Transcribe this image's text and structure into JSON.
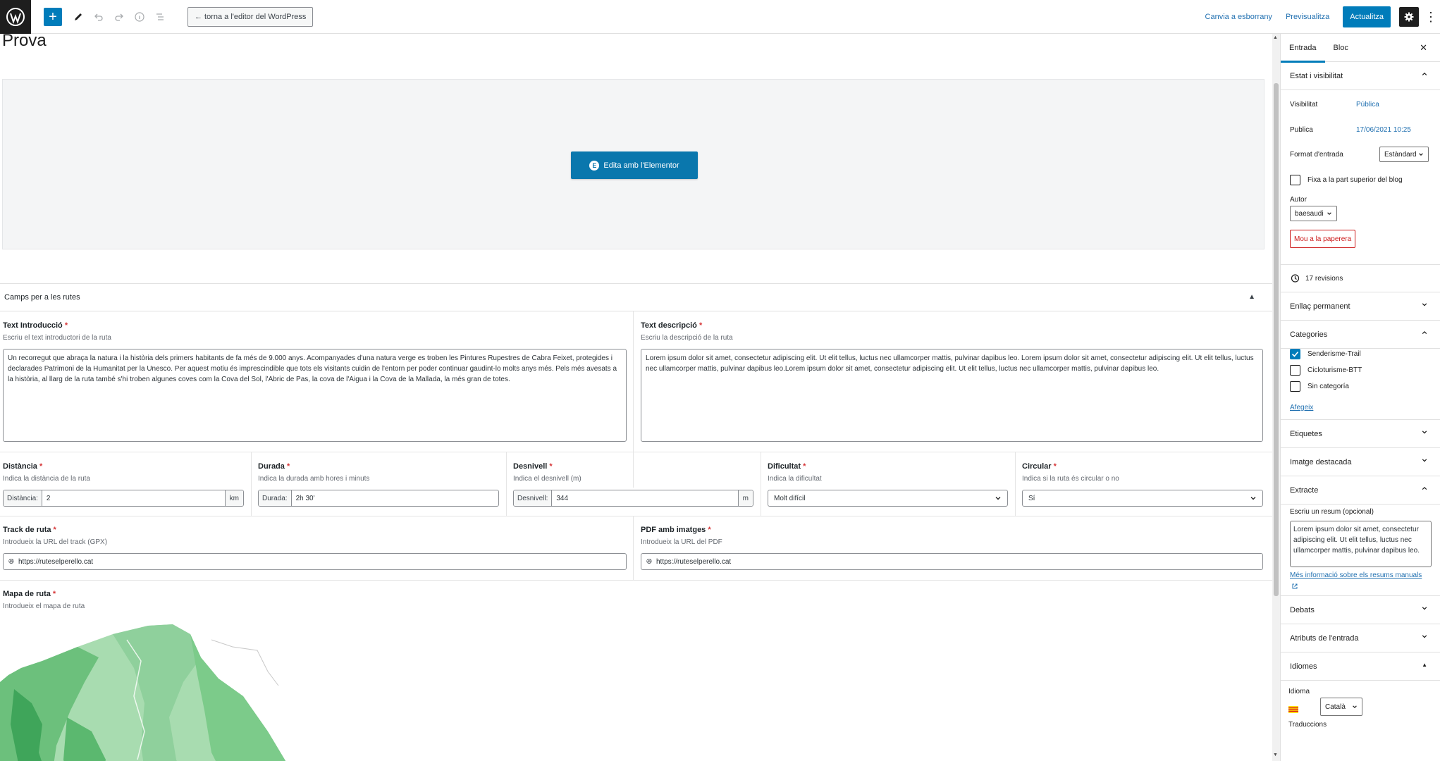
{
  "topbar": {
    "back_label": "← torna a l'editor del WordPress",
    "draft_label": "Canvia a esborrany",
    "preview_label": "Previsualitza",
    "update_label": "Actualitza"
  },
  "post": {
    "title": "Prova",
    "elementor_label": "Edita amb l'Elementor"
  },
  "metabox": {
    "title": "Camps per a les rutes"
  },
  "fields": {
    "intro": {
      "label": "Text Introducció",
      "required": "*",
      "desc": "Escriu el text introductori de la ruta",
      "value": "Un recorregut que abraça la natura i la història dels primers habitants de fa més de 9.000 anys. Acompanyades d'una natura verge es troben les Pintures Rupestres de Cabra Feixet, protegides i declarades Patrimoni de la Humanitat per la Unesco. Per aquest motiu és imprescindible que tots els visitants cuidin de l'entorn per poder continuar gaudint-lo molts anys més. Pels més avesats a la història, al llarg de la ruta també s'hi troben algunes coves com la Cova del Sol, l'Abric de Pas, la cova de l'Aigua i la Cova de la Mallada, la més gran de totes."
    },
    "descripcio": {
      "label": "Text descripció",
      "required": "*",
      "desc": "Escriu la descripció de la ruta",
      "value": "Lorem ipsum dolor sit amet, consectetur adipiscing elit. Ut elit tellus, luctus nec ullamcorper mattis, pulvinar dapibus leo. Lorem ipsum dolor sit amet, consectetur adipiscing elit. Ut elit tellus, luctus nec ullamcorper mattis, pulvinar dapibus leo.Lorem ipsum dolor sit amet, consectetur adipiscing elit. Ut elit tellus, luctus nec ullamcorper mattis, pulvinar dapibus leo."
    },
    "distancia": {
      "label": "Distància",
      "required": "*",
      "desc": "Indica la distància de la ruta",
      "prefix": "Distància:",
      "value": "2",
      "suffix": "km"
    },
    "durada": {
      "label": "Durada",
      "required": "*",
      "desc": "Indica la durada amb hores i minuts",
      "prefix": "Durada:",
      "value": "2h 30'"
    },
    "desnivell": {
      "label": "Desnivell",
      "required": "*",
      "desc": "Indica el desnivell (m)",
      "prefix": "Desnivell:",
      "value": "344",
      "suffix": "m"
    },
    "dificultat": {
      "label": "Dificultat",
      "required": "*",
      "desc": "Indica la dificultat",
      "value": "Molt difícil"
    },
    "circular": {
      "label": "Circular",
      "required": "*",
      "desc": "Indica si la ruta és circular o no",
      "value": "Sí"
    },
    "track": {
      "label": "Track de ruta",
      "required": "*",
      "desc": "Introdueix la URL del track (GPX)",
      "value": "https://ruteselperello.cat"
    },
    "pdf": {
      "label": "PDF amb imatges",
      "required": "*",
      "desc": "Introdueix la URL del PDF",
      "value": "https://ruteselperello.cat"
    },
    "mapa": {
      "label": "Mapa de ruta",
      "required": "*",
      "desc": "Introdueix el mapa de ruta"
    }
  },
  "sidebar": {
    "tab_post": "Entrada",
    "tab_block": "Bloc",
    "status_title": "Estat i visibilitat",
    "visibility_label": "Visibilitat",
    "visibility_value": "Pública",
    "publish_label": "Publica",
    "publish_value": "17/06/2021 10:25",
    "format_label": "Format d'entrada",
    "format_value": "Estàndard",
    "sticky_label": "Fixa a la part superior del blog",
    "author_label": "Autor",
    "author_value": "baesaudi",
    "trash_label": "Mou a la paperera",
    "revisions_label": "17 revisions",
    "permalink_title": "Enllaç permanent",
    "categories_title": "Categories",
    "categories": [
      {
        "label": "Senderisme-Trail",
        "checked": true
      },
      {
        "label": "Cicloturisme-BTT",
        "checked": false
      },
      {
        "label": "Sin categoría",
        "checked": false
      }
    ],
    "add_category": "Afegeix",
    "tags_title": "Etiquetes",
    "featured_title": "Imatge destacada",
    "excerpt_title": "Extracte",
    "excerpt_desc": "Escriu un resum (opcional)",
    "excerpt_value": "Lorem ipsum dolor sit amet, consectetur adipiscing elit. Ut elit tellus, luctus nec ullamcorper mattis, pulvinar dapibus leo.",
    "excerpt_link": "Més informació sobre els resums manuals",
    "discussion_title": "Debats",
    "attributes_title": "Atributs de l'entrada",
    "languages_title": "Idiomes",
    "language_label": "Idioma",
    "language_value": "Català",
    "translations_label": "Traduccions"
  },
  "colors": {
    "accent": "#007cba",
    "required": "#d63638",
    "trash": "#cc1818"
  }
}
